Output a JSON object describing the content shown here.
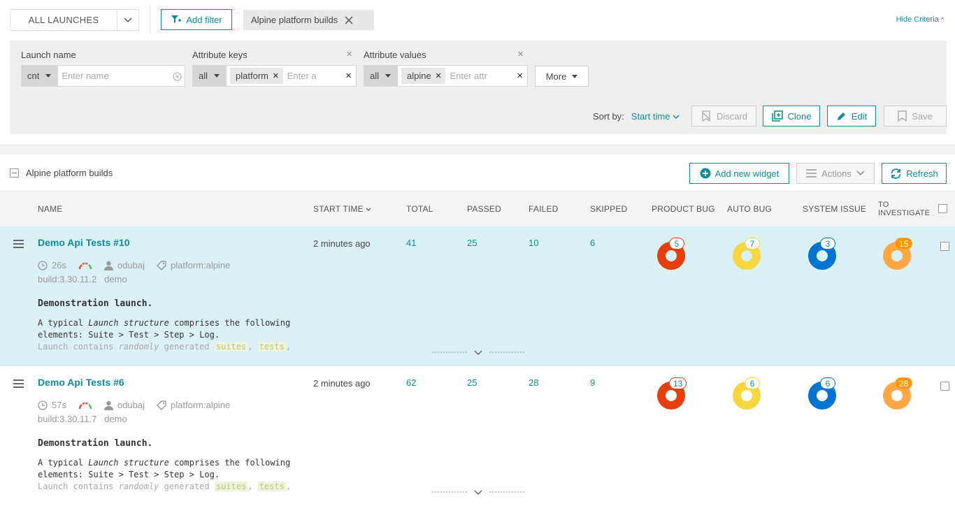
{
  "top": {
    "launches_select": "ALL LAUNCHES",
    "add_filter": "Add filter",
    "active_filter": "Alpine platform builds",
    "hide_criteria": "Hide Criteria"
  },
  "criteria": {
    "launch_name_label": "Launch name",
    "launch_name_condition": "cnt",
    "launch_name_placeholder": "Enter name",
    "attr_keys_label": "Attribute keys",
    "attr_keys_condition": "all",
    "attr_keys_chip": "platform",
    "attr_keys_placeholder": "Enter a",
    "attr_values_label": "Attribute values",
    "attr_values_condition": "all",
    "attr_values_chip": "alpine",
    "attr_values_placeholder": "Enter attr",
    "more": "More",
    "sort_by_label": "Sort by:",
    "sort_by_value": "Start time",
    "discard": "Discard",
    "clone": "Clone",
    "edit": "Edit",
    "save": "Save"
  },
  "toolbar": {
    "filter_name": "Alpine platform builds",
    "add_widget": "Add new widget",
    "actions": "Actions",
    "refresh": "Refresh"
  },
  "table": {
    "headers": {
      "name": "NAME",
      "start_time": "START TIME",
      "total": "TOTAL",
      "passed": "PASSED",
      "failed": "FAILED",
      "skipped": "SKIPPED",
      "product_bug": "PRODUCT BUG",
      "auto_bug": "AUTO BUG",
      "system_issue": "SYSTEM ISSUE",
      "to_investigate_1": "TO",
      "to_investigate_2": "INVESTIGATE"
    },
    "rows": [
      {
        "name": "Demo Api Tests #10",
        "duration": "26s",
        "owner": "odubaj",
        "attribute": "platform:alpine",
        "attrs2": "build:3.30.11.2   demo",
        "desc_title": "Demonstration launch.",
        "desc_line1_a": "A typical ",
        "desc_line1_em": "Launch structure",
        "desc_line1_b": " comprises the following",
        "desc_line2": "elements: Suite > Test > Step > Log.",
        "desc_line3_a": "Launch contains ",
        "desc_line3_em": "randomly",
        "desc_line3_b": " generated ",
        "desc_tag1": "suites",
        "desc_tag2": "tests",
        "start_time": "2 minutes ago",
        "total": "41",
        "passed": "25",
        "failed": "10",
        "skipped": "6",
        "product_bug": "5",
        "auto_bug": "7",
        "system_issue": "3",
        "to_investigate": "15"
      },
      {
        "name": "Demo Api Tests #6",
        "duration": "57s",
        "owner": "odubaj",
        "attribute": "platform:alpine",
        "attrs2": "build:3.30.11.7   demo",
        "desc_title": "Demonstration launch.",
        "desc_line1_a": "A typical ",
        "desc_line1_em": "Launch structure",
        "desc_line1_b": " comprises the following",
        "desc_line2": "elements: Suite > Test > Step > Log.",
        "desc_line3_a": "Launch contains ",
        "desc_line3_em": "randomly",
        "desc_line3_b": " generated ",
        "desc_tag1": "suites",
        "desc_tag2": "tests",
        "start_time": "2 minutes ago",
        "total": "62",
        "passed": "25",
        "failed": "28",
        "skipped": "9",
        "product_bug": "13",
        "auto_bug": "6",
        "system_issue": "6",
        "to_investigate": "28"
      }
    ]
  },
  "colors": {
    "accent": "#0e8c9a",
    "product_bug": "#e73c0c",
    "auto_bug": "#f7d63e",
    "system_issue": "#0274d1",
    "to_investigate": "#ffa745",
    "selected_row": "#daf1f5"
  },
  "icons": [
    "chevron-down-icon",
    "add-filter-icon",
    "close-icon",
    "clock-icon",
    "user-icon",
    "tag-icon",
    "hamburger-icon",
    "plus-circle-icon",
    "refresh-icon",
    "clone-icon",
    "pencil-icon",
    "bookmark-icon",
    "discard-icon"
  ]
}
